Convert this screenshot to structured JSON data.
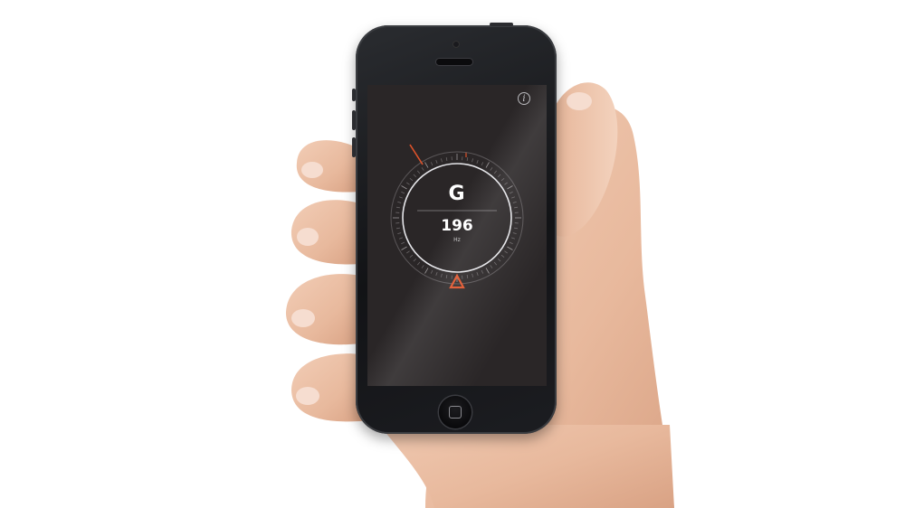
{
  "tuner": {
    "note": "G",
    "frequency": "196",
    "unit": "Hz",
    "accent_color": "#e0532a",
    "ring_color": "#d8d8dc"
  },
  "icons": {
    "info": "i"
  }
}
